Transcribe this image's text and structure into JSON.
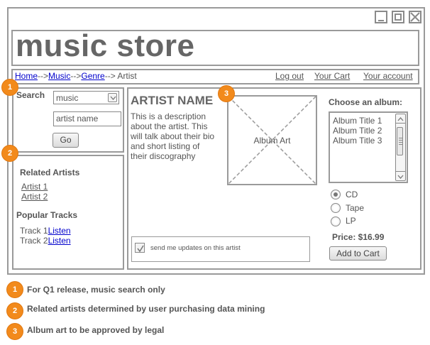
{
  "app": {
    "logo": "music store"
  },
  "window_controls": {
    "minimize_icon": "minimize-icon",
    "maximize_icon": "maximize-icon",
    "close_icon": "close-icon"
  },
  "breadcrumb": {
    "home": "Home",
    "sep1": "-->",
    "music": "Music",
    "sep2": "-->",
    "genre": "Genre",
    "sep3": "-->",
    "current": " Artist"
  },
  "nav": {
    "logout": "Log out",
    "cart": "Your Cart",
    "account": "Your account"
  },
  "search": {
    "label": "Search",
    "category": "music",
    "query": "artist name",
    "go": "Go"
  },
  "related": {
    "title": "Related Artists",
    "artists": [
      "Artist 1",
      "Artist 2"
    ]
  },
  "popular": {
    "title": "Popular Tracks",
    "tracks": [
      {
        "name": "Track 1",
        "action": "Listen"
      },
      {
        "name": "Track 2",
        "action": "Listen"
      }
    ]
  },
  "artist": {
    "name": "ARTIST NAME",
    "lines": [
      "This is a description",
      "about the artist.  This",
      "will talk about their bio",
      "and short listing of",
      "their discography"
    ]
  },
  "album_art": {
    "label": "Album Art"
  },
  "updates": {
    "label": "send me updates on this artist",
    "checked": true
  },
  "album_select": {
    "title": "Choose an album:",
    "albums": [
      "Album Title 1",
      "Album Title 2",
      "Album Title 3"
    ]
  },
  "formats": {
    "options": [
      "CD",
      "Tape",
      "LP"
    ],
    "selected": "CD"
  },
  "price": {
    "text": "Price: $16.99"
  },
  "cart_button": {
    "label": "Add to Cart"
  },
  "badges": [
    "1",
    "2",
    "3"
  ],
  "notes": [
    {
      "num": "1",
      "text": "For Q1 release, music search only"
    },
    {
      "num": "2",
      "text": "Related artists determined by user purchasing data mining"
    },
    {
      "num": "3",
      "text": "Album art to be approved by legal"
    }
  ],
  "colors": {
    "badge": "#f28a1c",
    "link": "#0000cc",
    "border": "#9a9a9a"
  }
}
